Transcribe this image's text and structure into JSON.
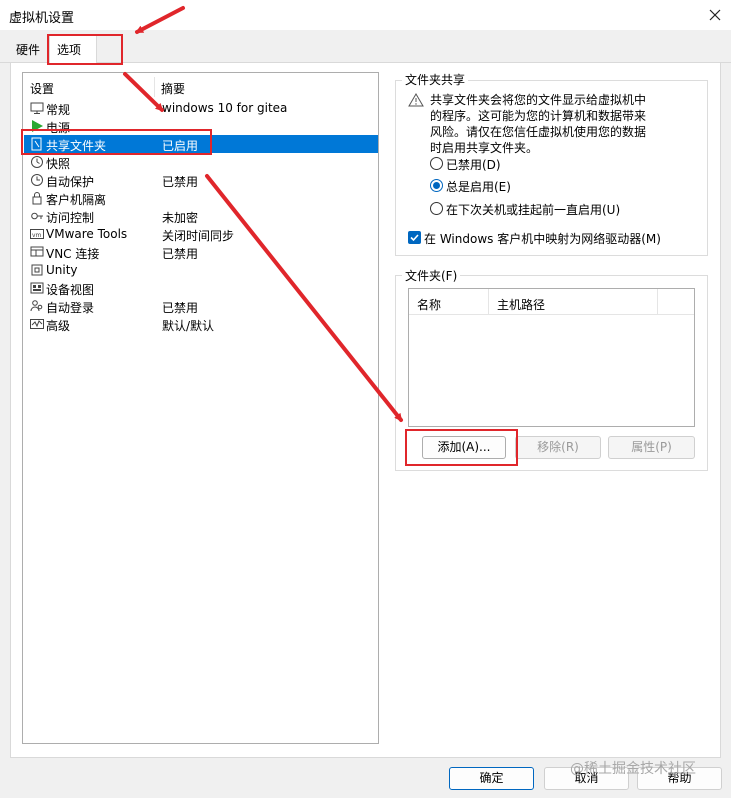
{
  "window": {
    "title": "虚拟机设置"
  },
  "tabs": [
    {
      "label": "硬件"
    },
    {
      "label": "选项"
    }
  ],
  "settings_list": {
    "columns": [
      "设置",
      "摘要"
    ],
    "rows": [
      {
        "name": "常规",
        "summary": "windows 10 for gitea",
        "icon": "monitor-icon"
      },
      {
        "name": "电源",
        "summary": "",
        "icon": "power-play-icon"
      },
      {
        "name": "共享文件夹",
        "summary": "已启用",
        "icon": "shared-folder-icon"
      },
      {
        "name": "快照",
        "summary": "",
        "icon": "snapshot-icon"
      },
      {
        "name": "自动保护",
        "summary": "已禁用",
        "icon": "clock-icon"
      },
      {
        "name": "客户机隔离",
        "summary": "",
        "icon": "lock-icon"
      },
      {
        "name": "访问控制",
        "summary": "未加密",
        "icon": "key-icon"
      },
      {
        "name": "VMware Tools",
        "summary": "关闭时间同步",
        "icon": "vmware-tools-icon"
      },
      {
        "name": "VNC 连接",
        "summary": "已禁用",
        "icon": "vnc-icon"
      },
      {
        "name": "Unity",
        "summary": "",
        "icon": "unity-icon"
      },
      {
        "name": "设备视图",
        "summary": "",
        "icon": "device-view-icon"
      },
      {
        "name": "自动登录",
        "summary": "已禁用",
        "icon": "users-icon"
      },
      {
        "name": "高级",
        "summary": "默认/默认",
        "icon": "advanced-icon"
      }
    ],
    "selected_index": 2
  },
  "folder_sharing": {
    "group_title": "文件夹共享",
    "warning_lines": [
      "共享文件夹会将您的文件显示给虚拟机中",
      "的程序。这可能为您的计算机和数据带来",
      "风险。请仅在您信任虚拟机使用您的数据",
      "时启用共享文件夹。"
    ],
    "options": [
      {
        "label": "已禁用(D)",
        "selected": false
      },
      {
        "label": "总是启用(E)",
        "selected": true
      },
      {
        "label": "在下次关机或挂起前一直启用(U)",
        "selected": false
      }
    ],
    "map_drive_label": "在 Windows 客户机中映射为网络驱动器(M)",
    "map_drive_checked": true
  },
  "folders": {
    "group_title": "文件夹(F)",
    "columns": [
      "名称",
      "主机路径"
    ],
    "add_label": "添加(A)...",
    "remove_label": "移除(R)",
    "properties_label": "属性(P)"
  },
  "footer": {
    "ok_label": "确定",
    "cancel_label": "取消",
    "help_label": "帮助"
  },
  "watermark": "@稀土掘金技术社区",
  "colors": {
    "selection": "#0078d7",
    "accent": "#0067c0",
    "annotation": "#e0262b"
  }
}
